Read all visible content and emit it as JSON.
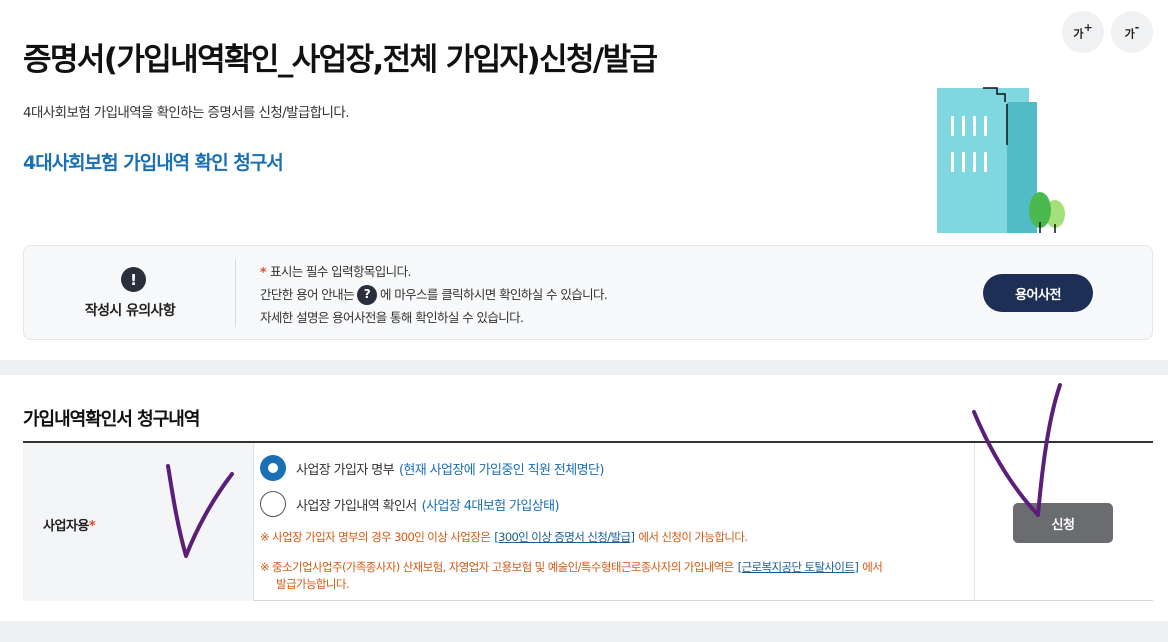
{
  "header": {
    "title": "증명서(가입내역확인_사업장,전체 가입자)신청/발급",
    "description": "4대사회보험 가입내역을 확인하는 증명서를 신청/발급합니다.",
    "subtitle": "4대사회보험 가입내역 확인 청구서",
    "font_up_label": "가",
    "font_up_mark": "+",
    "font_down_label": "가",
    "font_down_mark": "-"
  },
  "notice": {
    "icon_glyph": "!",
    "label": "작성시 유의사항",
    "line1_star": "*",
    "line1": "표시는 필수 입력항목입니다.",
    "line2_before": "간단한 용어 안내는",
    "line2_icon": "?",
    "line2_after": "에 마우스를 클릭하시면 확인하실 수 있습니다.",
    "line3": "자세한 설명은 용어사전을 통해 확인하실 수 있습니다.",
    "dict_button": "용어사전"
  },
  "request": {
    "section_title": "가입내역확인서 청구내역",
    "field_label": "사업자용",
    "required_mark": "*",
    "options": [
      {
        "label": "사업장 가입자 명부",
        "hint": "(현재 사업장에 가입중인 직원 전체명단)",
        "checked": true
      },
      {
        "label": "사업장 가입내역 확인서",
        "hint": "(사업장 4대보험 가입상태)",
        "checked": false
      }
    ],
    "warning1_before": "※ 사업장 가입자 명부의 경우 300인 이상 사업장은",
    "warning1_link": "[300인 이상 증명서 신청/발급]",
    "warning1_after": "에서 신청이 가능합니다.",
    "warning2_before": "※ 중소기업사업주(가족종사자) 산재보험, 자영업자 고용보험 및 예술인/특수형태근로종사자의 가입내역은",
    "warning2_link": "[근로복지공단 토탈사이트]",
    "warning2_after": "에서",
    "warning2_line2": "발급가능합니다.",
    "apply_button": "신청"
  },
  "colors": {
    "accent_blue": "#1a6fb5",
    "dark_navy": "#1e2f55",
    "warning_orange": "#d45a12",
    "required_red": "#e0462f",
    "scribble_purple": "#5b1f7a",
    "building_cyan": "#7fd8e0",
    "building_side": "#52bcc6",
    "tree_green": "#4cb850"
  },
  "icons": [
    "font-increase-icon",
    "font-decrease-icon",
    "building-illustration",
    "exclamation-icon",
    "question-icon",
    "radio-checked-icon",
    "radio-unchecked-icon"
  ]
}
